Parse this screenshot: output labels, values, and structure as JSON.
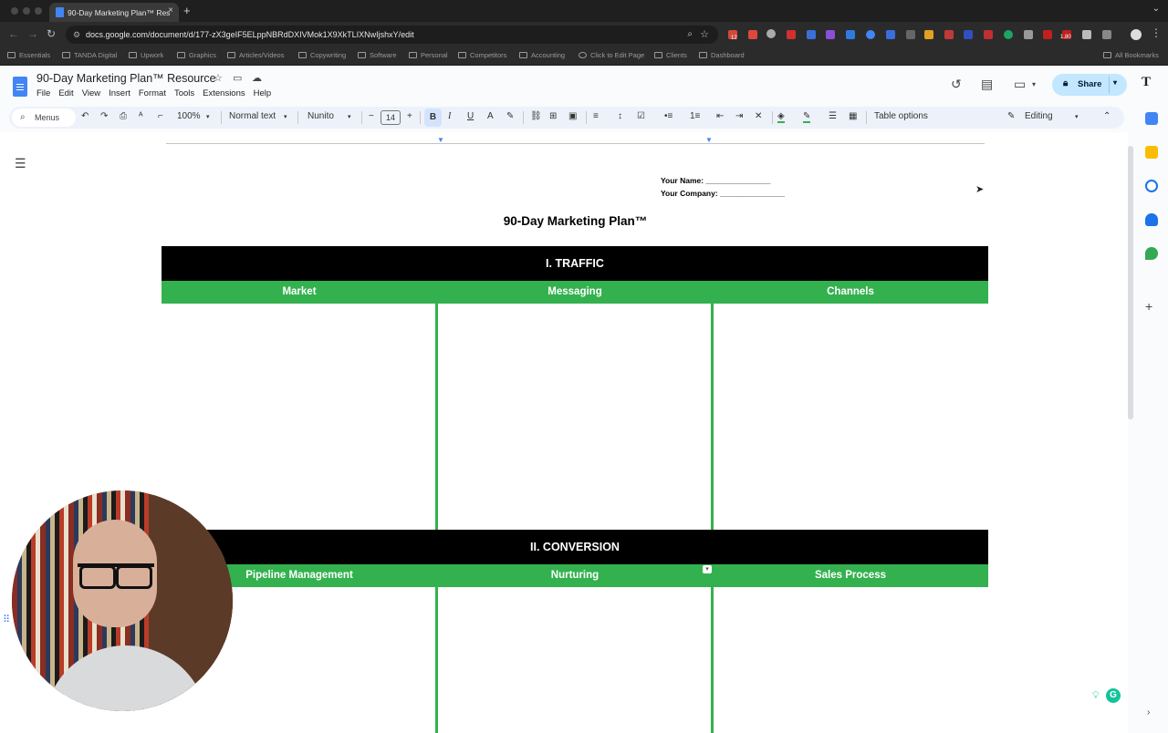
{
  "browser": {
    "tab_title": "90-Day Marketing Plan™ Res",
    "url": "docs.google.com/document/d/177-zX3geIF5ELppNBRdDXIVMok1X9XkTLIXNwIjshxY/edit",
    "bookmarks": [
      "Essentials",
      "TANDA Digital",
      "Upwork",
      "Graphics",
      "Articles/Videos",
      "Copywriting",
      "Software",
      "Personal",
      "Competitors",
      "Accounting",
      "Click to Edit Page",
      "Clients",
      "Dashboard"
    ],
    "all_bookmarks": "All Bookmarks",
    "ext_badge_1": "12",
    "ext_badge_2": "1.80"
  },
  "docs": {
    "title": "90-Day Marketing Plan™ Resource",
    "menus": [
      "File",
      "Edit",
      "View",
      "Insert",
      "Format",
      "Tools",
      "Extensions",
      "Help"
    ],
    "share_label": "Share"
  },
  "toolbar": {
    "search": "Menus",
    "zoom": "100%",
    "style": "Normal text",
    "font": "Nunito",
    "font_size": "14",
    "table_options": "Table options",
    "mode": "Editing"
  },
  "document": {
    "your_name": "Your Name: _______________",
    "your_company": "Your Company: _______________",
    "title": "90-Day Marketing Plan™",
    "sections": [
      {
        "heading": "I.  TRAFFIC",
        "columns": [
          "Market",
          "Messaging",
          "Channels"
        ]
      },
      {
        "heading": "II.  CONVERSION",
        "columns": [
          "Pipeline Management",
          "Nurturing",
          "Sales Process"
        ]
      }
    ]
  },
  "colors": {
    "section_header_bg": "#000000",
    "column_header_bg": "#34b14f",
    "share_bg": "#c2e7ff"
  }
}
